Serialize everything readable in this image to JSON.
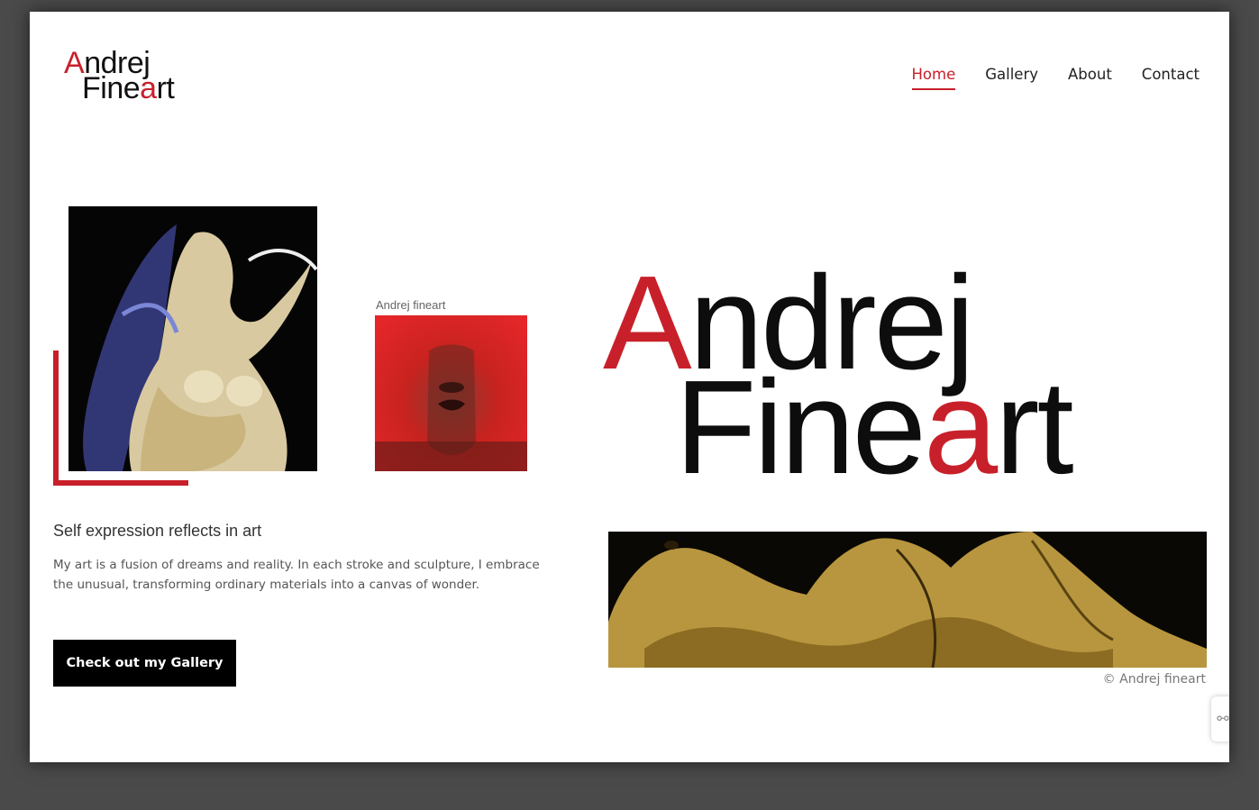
{
  "header": {
    "logo": {
      "line1_first": "A",
      "line1_rest": "ndrej",
      "line2_first": "Fine",
      "line2_red": "a",
      "line2_rest": "rt"
    },
    "nav": [
      {
        "label": "Home",
        "active": true
      },
      {
        "label": "Gallery",
        "active": false
      },
      {
        "label": "About",
        "active": false
      },
      {
        "label": "Contact",
        "active": false
      }
    ]
  },
  "hero": {
    "artwork_caption": "Andrej fineart",
    "big_logo": {
      "line1_first": "A",
      "line1_rest": "ndrej",
      "line2_first": "Fine",
      "line2_red": "a",
      "line2_rest": "rt"
    },
    "tagline": "Self expression reflects in art",
    "intro": "My art is a fusion of dreams and reality. In each stroke and sculpture, I embrace the unusual, transforming ordinary materials into a canvas of wonder.",
    "cta_label": "Check out my Gallery",
    "copyright": "© Andrej fineart"
  },
  "colors": {
    "accent": "#c8202a",
    "text": "#222222",
    "button_bg": "#000000"
  },
  "icons": {
    "side_widget": "accessibility-icon"
  }
}
